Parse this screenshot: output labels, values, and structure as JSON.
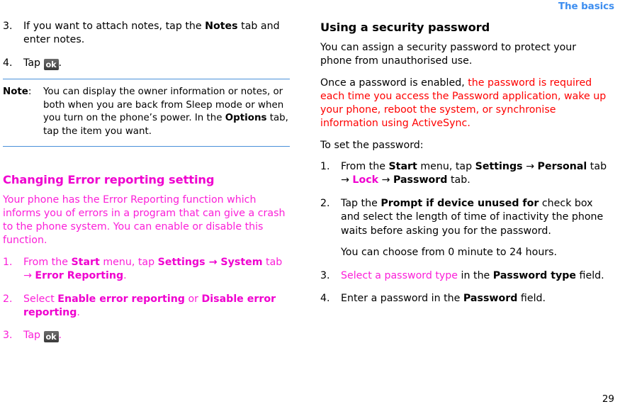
{
  "header": {
    "title": "The basics"
  },
  "colors": {
    "header_blue": "#3d8ef0",
    "rule_blue": "#4a90d9",
    "magenta_body": "#fb1fd8",
    "magenta_bold": "#ef00cf",
    "red": "#fe0000",
    "text": "#000000",
    "okkey_bg": "#4a4a4a"
  },
  "left_column": {
    "steps_top": [
      {
        "num": "3.",
        "parts": [
          {
            "text": "If you want to attach notes, tap the ",
            "style": "plain"
          },
          {
            "text": "Notes",
            "style": "bold"
          },
          {
            "text": " tab and enter notes.",
            "style": "plain"
          }
        ]
      },
      {
        "num": "4.",
        "parts": [
          {
            "text": "Tap ",
            "style": "plain"
          },
          {
            "text": "ok",
            "style": "okkey"
          },
          {
            "text": ".",
            "style": "plain"
          }
        ]
      }
    ],
    "note": {
      "label": "Note",
      "label_colon": ":",
      "parts": [
        {
          "text": "You can display the owner information or notes, or both when you are back from Sleep mode or when you turn on the phone’s power. In the ",
          "style": "plain"
        },
        {
          "text": "Options",
          "style": "bold"
        },
        {
          "text": " tab, tap the item you want.",
          "style": "plain"
        }
      ]
    },
    "section": {
      "heading": "Changing Error reporting setting",
      "intro": "Your phone has the Error Reporting function which informs you of errors in a program that can give a crash to the phone system. You can enable or disable this function.",
      "steps": [
        {
          "num": "1.",
          "parts": [
            {
              "text": "From the ",
              "style": "magenta"
            },
            {
              "text": "Start",
              "style": "magenta-bold"
            },
            {
              "text": " menu, tap ",
              "style": "magenta"
            },
            {
              "text": "Settings",
              "style": "magenta-bold"
            },
            {
              "text": " → ",
              "style": "magenta-bold"
            },
            {
              "text": "System",
              "style": "magenta-bold"
            },
            {
              "text": " tab ",
              "style": "magenta"
            },
            {
              "text": "→ ",
              "style": "magenta"
            },
            {
              "text": "Error Reporting",
              "style": "magenta-bold"
            },
            {
              "text": ".",
              "style": "magenta"
            }
          ]
        },
        {
          "num": "2.",
          "parts": [
            {
              "text": "Select ",
              "style": "magenta"
            },
            {
              "text": "Enable error reporting",
              "style": "magenta-bold"
            },
            {
              "text": " or ",
              "style": "magenta"
            },
            {
              "text": "Disable error reporting",
              "style": "magenta-bold"
            },
            {
              "text": ".",
              "style": "magenta"
            }
          ]
        },
        {
          "num": "3.",
          "parts": [
            {
              "text": "Tap ",
              "style": "magenta"
            },
            {
              "text": "ok",
              "style": "okkey"
            },
            {
              "text": ".",
              "style": "magenta"
            }
          ]
        }
      ]
    }
  },
  "right_column": {
    "heading": "Using a security password",
    "paragraphs": [
      {
        "parts": [
          {
            "text": "You can assign a security password to protect your phone from unauthorised use.",
            "style": "plain"
          }
        ]
      },
      {
        "parts": [
          {
            "text": "Once a password is enabled, ",
            "style": "plain"
          },
          {
            "text": "the password is required each time you access the Password application, wake up your phone, reboot the system, or synchronise information using ActiveSync",
            "style": "red"
          },
          {
            "text": ".",
            "style": "red"
          }
        ]
      },
      {
        "parts": [
          {
            "text": "To set the password:",
            "style": "plain"
          }
        ]
      }
    ],
    "steps": [
      {
        "num": "1.",
        "parts": [
          {
            "text": "From the ",
            "style": "plain"
          },
          {
            "text": "Start",
            "style": "bold"
          },
          {
            "text": " menu, tap ",
            "style": "plain"
          },
          {
            "text": "Settings",
            "style": "bold"
          },
          {
            "text": " → ",
            "style": "plain"
          },
          {
            "text": "Personal",
            "style": "bold"
          },
          {
            "text": " tab → ",
            "style": "plain"
          },
          {
            "text": "Lock",
            "style": "magenta-bold"
          },
          {
            "text": " → ",
            "style": "plain"
          },
          {
            "text": "Password",
            "style": "bold"
          },
          {
            "text": " tab.",
            "style": "plain"
          }
        ]
      },
      {
        "num": "2.",
        "parts": [
          {
            "text": "Tap the ",
            "style": "plain"
          },
          {
            "text": "Prompt if device unused for",
            "style": "bold"
          },
          {
            "text": " check box and select the length of time of inactivity the phone waits before asking you for the password.",
            "style": "plain"
          }
        ],
        "sub": "You can choose from 0 minute to 24 hours."
      },
      {
        "num": "3.",
        "parts": [
          {
            "text": "Select a password type",
            "style": "magenta"
          },
          {
            "text": " in the ",
            "style": "plain"
          },
          {
            "text": "Password type",
            "style": "bold"
          },
          {
            "text": " field.",
            "style": "plain"
          }
        ]
      },
      {
        "num": "4.",
        "parts": [
          {
            "text": "Enter a password in the ",
            "style": "plain"
          },
          {
            "text": "Password",
            "style": "bold"
          },
          {
            "text": " field.",
            "style": "plain"
          }
        ]
      }
    ]
  },
  "folio": {
    "page_number": "29"
  }
}
